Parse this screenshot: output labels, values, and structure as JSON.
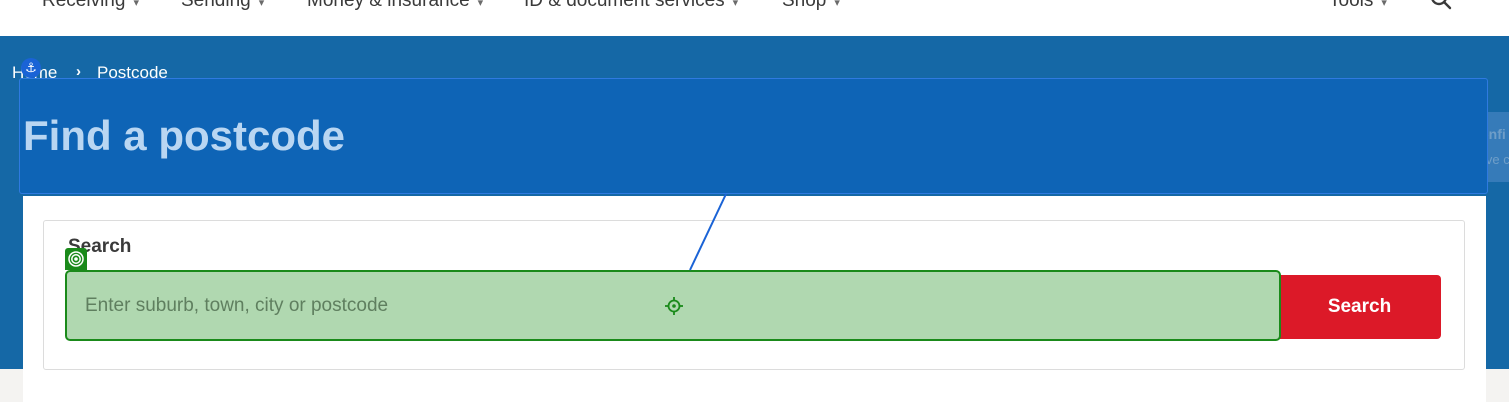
{
  "nav": {
    "items": [
      {
        "label": "Receiving"
      },
      {
        "label": "Sending"
      },
      {
        "label": "Money & insurance"
      },
      {
        "label": "ID & document services"
      },
      {
        "label": "Shop"
      },
      {
        "label": "Tools"
      }
    ],
    "search_icon": "search-icon",
    "chevron_icon": "chevron-down-icon"
  },
  "breadcrumb": {
    "home": "Home",
    "separator": "›",
    "current": "Postcode"
  },
  "page": {
    "title": "Find a postcode"
  },
  "side_panel": {
    "title": "Confi",
    "subtitle": "Save c"
  },
  "search": {
    "label": "Search",
    "placeholder": "Enter suburb, town, city or postcode",
    "value": "",
    "button_label": "Search"
  },
  "colors": {
    "hero": "#1568a6",
    "accent_button": "#dc1928",
    "title_overlay": "#0e64b6",
    "input_overlay": "#b0d8b0",
    "input_border": "#1a8a1a"
  }
}
